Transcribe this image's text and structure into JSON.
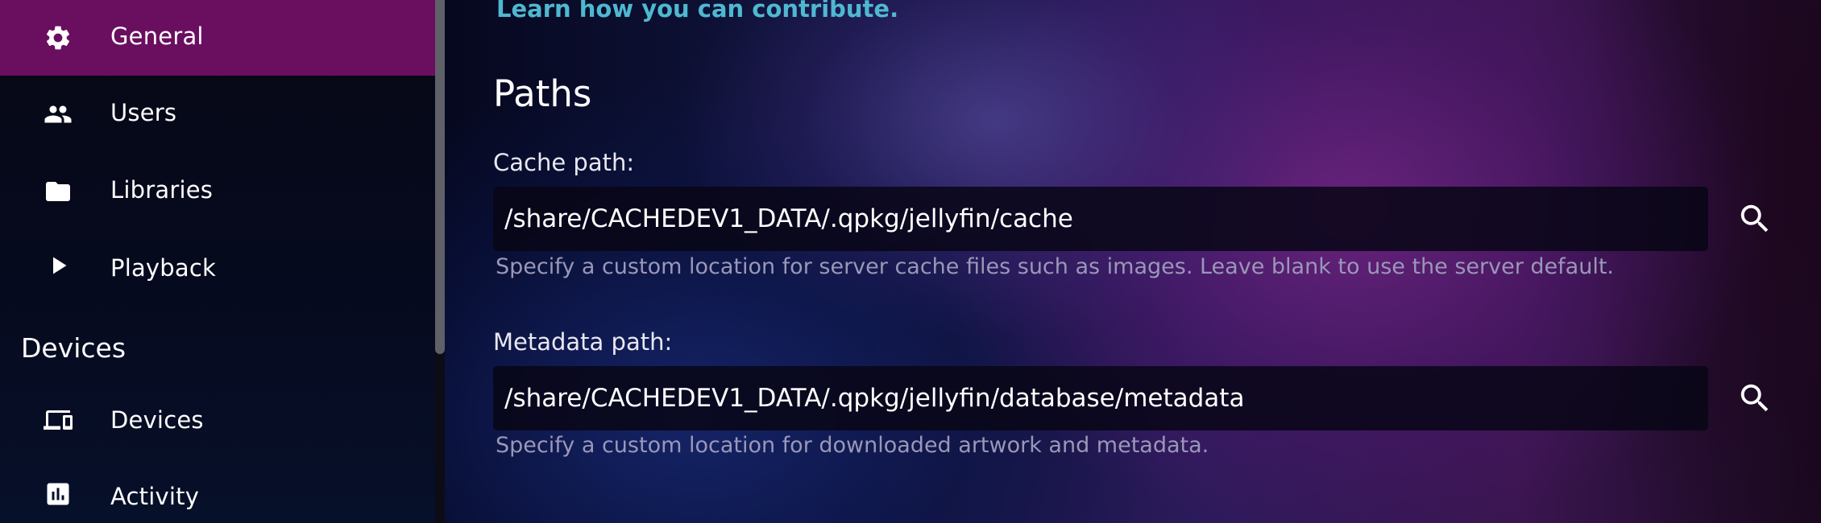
{
  "sidebar": {
    "items": [
      {
        "label": "General",
        "icon": "gear-icon",
        "active": true
      },
      {
        "label": "Users",
        "icon": "users-icon",
        "active": false
      },
      {
        "label": "Libraries",
        "icon": "folder-icon",
        "active": false
      },
      {
        "label": "Playback",
        "icon": "play-icon",
        "active": false
      }
    ],
    "devices_section": {
      "header": "Devices",
      "items": [
        {
          "label": "Devices",
          "icon": "devices-icon"
        },
        {
          "label": "Activity",
          "icon": "activity-icon"
        }
      ]
    },
    "active_color": "#6a0f5f"
  },
  "main": {
    "contribute_link": "Learn how you can contribute.",
    "paths_section": {
      "title": "Paths",
      "cache": {
        "label": "Cache path:",
        "value": "/share/CACHEDEV1_DATA/.qpkg/jellyfin/cache",
        "help": "Specify a custom location for server cache files such as images. Leave blank to use the server default.",
        "button_icon": "search-icon"
      },
      "metadata": {
        "label": "Metadata path:",
        "value": "/share/CACHEDEV1_DATA/.qpkg/jellyfin/database/metadata",
        "help": "Specify a custom location for downloaded artwork and metadata.",
        "button_icon": "search-icon"
      }
    },
    "link_color": "#4fb8d1"
  }
}
